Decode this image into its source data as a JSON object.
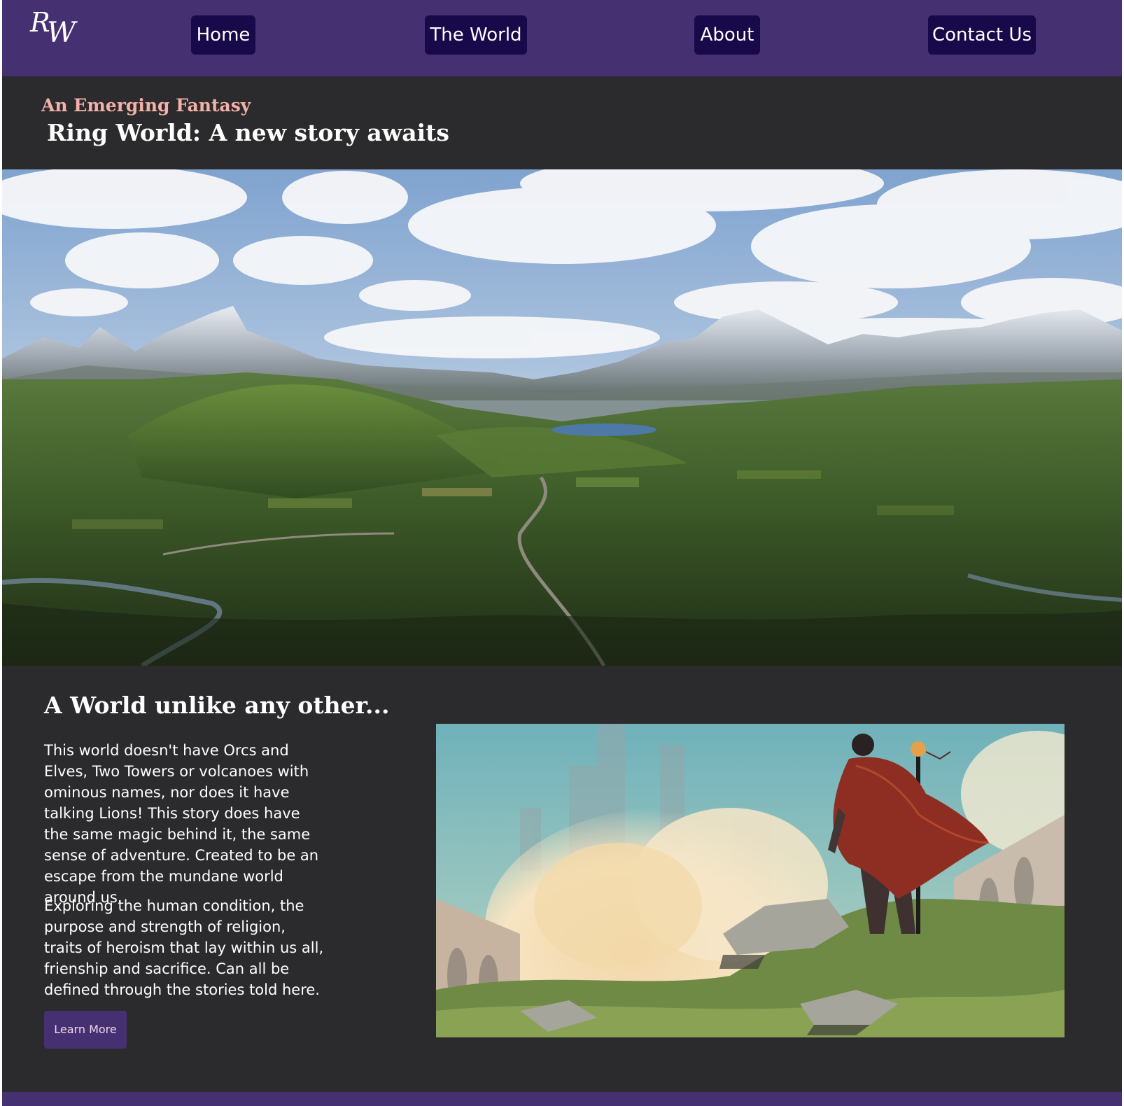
{
  "nav": {
    "logo": {
      "r": "R",
      "w": "W"
    },
    "items": [
      {
        "label": "Home"
      },
      {
        "label": "The World"
      },
      {
        "label": "About"
      },
      {
        "label": "Contact Us"
      }
    ]
  },
  "hero": {
    "eyebrow": "An Emerging Fantasy",
    "title": "Ring World: A new story awaits"
  },
  "intro": {
    "title": "A World unlike any other...",
    "paragraphs": [
      "This world doesn't have Orcs and Elves, Two Towers or volcanoes with ominous names, nor does it have talking Lions! This story does have the same magic behind it, the same sense of adventure. Created to be an escape from the mundane world around us.",
      "Exploring the human condition, the purpose and strength of religion, traits of heroism that lay within us all, frienship and sacrifice. Can all be defined through the stories told here."
    ],
    "button_label": "Learn More"
  },
  "colors": {
    "nav_bg": "#453072",
    "nav_button_bg": "#180a4a",
    "page_bg": "#2b2a2c",
    "eyebrow": "#f4b1a8",
    "button_text": "#f2d7e8"
  }
}
